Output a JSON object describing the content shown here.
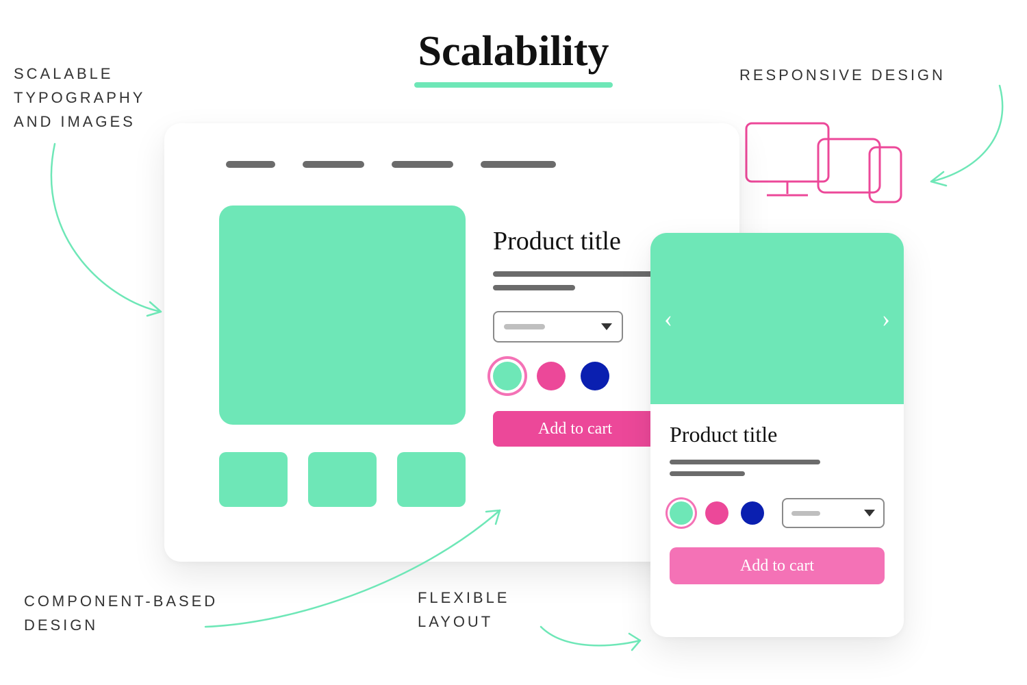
{
  "title": "Scalability",
  "annotations": {
    "top_left": "SCALABLE\nTYPOGRAPHY\nAND IMAGES",
    "top_right": "RESPONSIVE DESIGN",
    "bottom_left": "COMPONENT-BASED\nDESIGN",
    "bottom_right": "FLEXIBLE\nLAYOUT"
  },
  "desktop": {
    "product_title": "Product title",
    "cta_label": "Add to cart",
    "swatch_colors": [
      "#6EE7B7",
      "#EC4899",
      "#0A1FB0"
    ],
    "selected_swatch": 0
  },
  "mobile": {
    "product_title": "Product title",
    "cta_label": "Add to cart",
    "swatch_colors": [
      "#6EE7B7",
      "#EC4899",
      "#0A1FB0"
    ],
    "selected_swatch": 0
  },
  "palette": {
    "mint": "#6EE7B7",
    "magenta": "#EC4899",
    "pink": "#F472B6",
    "navy": "#0A1FB0",
    "gray_bar": "#6b6b6b"
  }
}
